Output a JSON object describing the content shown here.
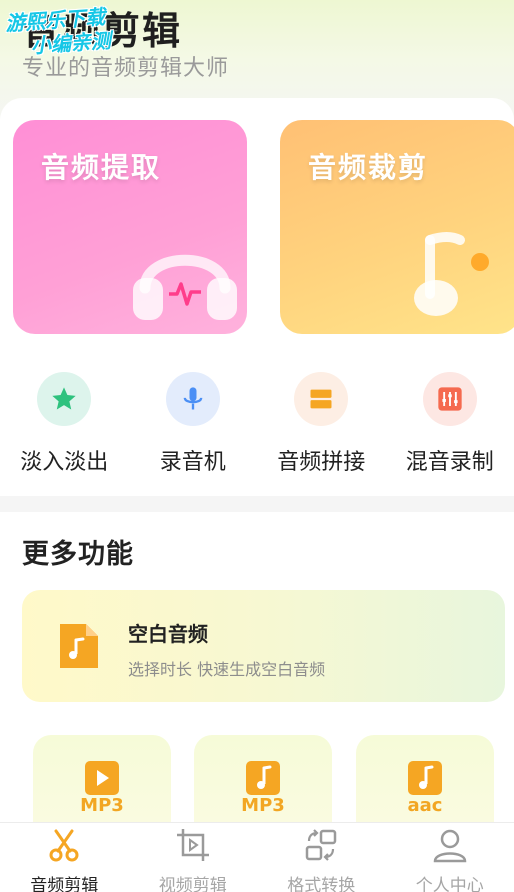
{
  "watermark": {
    "line1": "游熙乐下载",
    "line2": "小编亲测"
  },
  "header": {
    "title": "音频剪辑",
    "subtitle": "专业的音频剪辑大师"
  },
  "main_cards": [
    {
      "label": "音频提取",
      "icon": "headphones-icon"
    },
    {
      "label": "音频裁剪",
      "icon": "music-note-icon"
    }
  ],
  "quick_actions": [
    {
      "label": "淡入淡出",
      "icon": "star-icon",
      "color": "#2ec27e"
    },
    {
      "label": "录音机",
      "icon": "microphone-icon",
      "color": "#4b8ff5"
    },
    {
      "label": "音频拼接",
      "icon": "splice-icon",
      "color": "#f5a623"
    },
    {
      "label": "混音录制",
      "icon": "mixer-icon",
      "color": "#f56a4f"
    }
  ],
  "more": {
    "title": "更多功能",
    "blank_audio": {
      "title": "空白音频",
      "desc": "选择时长 快速生成空白音频"
    },
    "formats": [
      {
        "label": "MP3",
        "icon": "video-file-icon"
      },
      {
        "label": "MP3",
        "icon": "music-file-icon"
      },
      {
        "label": "aac",
        "icon": "music-file-icon"
      }
    ]
  },
  "tabbar": [
    {
      "label": "音频剪辑",
      "icon": "scissors-icon",
      "active": true
    },
    {
      "label": "视频剪辑",
      "icon": "crop-icon",
      "active": false
    },
    {
      "label": "格式转换",
      "icon": "convert-icon",
      "active": false
    },
    {
      "label": "个人中心",
      "icon": "user-icon",
      "active": false
    }
  ],
  "colors": {
    "accent": "#f2a623",
    "pink": "#ff8fd6",
    "orange": "#ffc074"
  }
}
